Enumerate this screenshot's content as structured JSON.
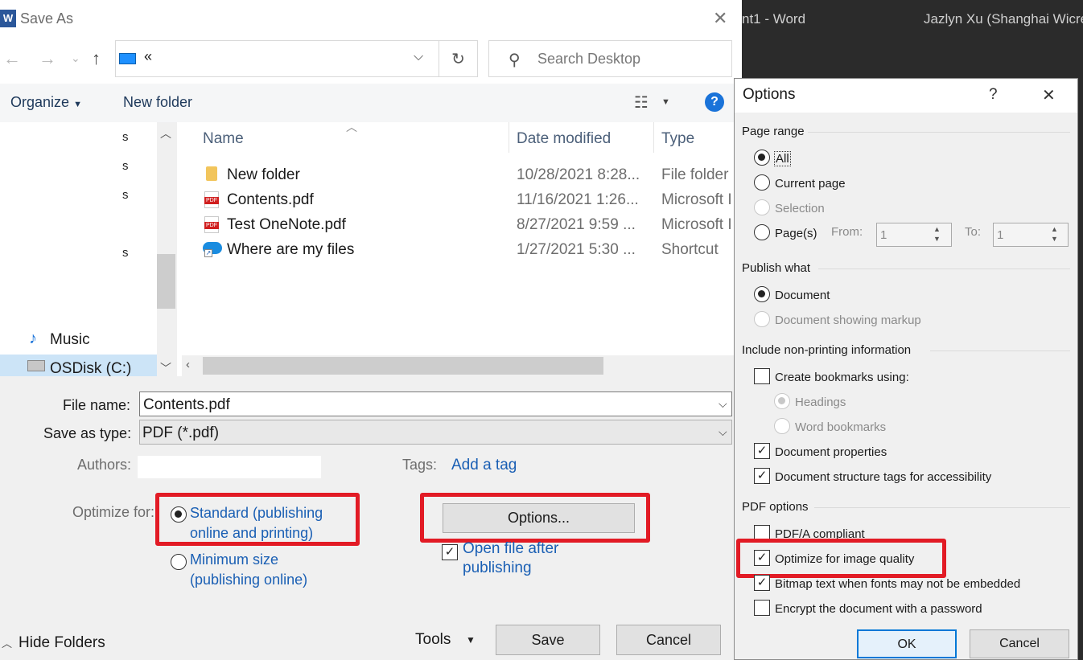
{
  "word": {
    "title": "nt1  -  Word",
    "user": "Jazlyn Xu (Shanghai Wicre"
  },
  "saveas": {
    "title": "Save As",
    "word_icon": "W",
    "address_text": "«",
    "search_placeholder": "Search Desktop",
    "organize": "Organize",
    "new_folder": "New folder",
    "nav_items": {
      "music": "Music",
      "osdisk": "OSDisk (C:)"
    },
    "columns": {
      "name": "Name",
      "date": "Date modified",
      "type": "Type"
    },
    "files": [
      {
        "name": "New folder",
        "date": "10/28/2021 8:28...",
        "type": "File folder"
      },
      {
        "name": "Contents.pdf",
        "date": "11/16/2021 1:26...",
        "type": "Microsoft I"
      },
      {
        "name": "Test OneNote.pdf",
        "date": "8/27/2021 9:59 ...",
        "type": "Microsoft I"
      },
      {
        "name": "Where are my files",
        "date": "1/27/2021 5:30 ...",
        "type": "Shortcut"
      }
    ],
    "file_name_label": "File name:",
    "file_name_value": "Contents.pdf",
    "save_type_label": "Save as type:",
    "save_type_value": "PDF (*.pdf)",
    "authors_label": "Authors:",
    "tags_label": "Tags:",
    "add_tag": "Add a tag",
    "optimize_label": "Optimize for:",
    "opt_standard_1": "Standard (publishing",
    "opt_standard_2": "online and printing)",
    "opt_min_1": "Minimum size",
    "opt_min_2": "(publishing online)",
    "options_button": "Options...",
    "open_after_1": "Open file after",
    "open_after_2": "publishing",
    "hide_folders": "Hide Folders",
    "tools": "Tools",
    "save": "Save",
    "cancel": "Cancel"
  },
  "options": {
    "title": "Options",
    "help": "?",
    "page_range": "Page range",
    "all": "All",
    "current_page": "Current page",
    "selection": "Selection",
    "pages": "Page(s)",
    "from": "From:",
    "to": "To:",
    "from_value": "1",
    "to_value": "1",
    "publish_what": "Publish what",
    "document": "Document",
    "document_markup": "Document showing markup",
    "nonprinting": "Include non-printing information",
    "create_bookmarks": "Create bookmarks using:",
    "headings": "Headings",
    "word_bookmarks": "Word bookmarks",
    "doc_properties": "Document properties",
    "doc_structure": "Document structure tags for accessibility",
    "pdf_options": "PDF options",
    "pdfa": "PDF/A compliant",
    "optimize_image": "Optimize for image quality",
    "bitmap_text": "Bitmap text when fonts may not be embedded",
    "encrypt": "Encrypt the document with a password",
    "ok": "OK",
    "cancel": "Cancel"
  }
}
